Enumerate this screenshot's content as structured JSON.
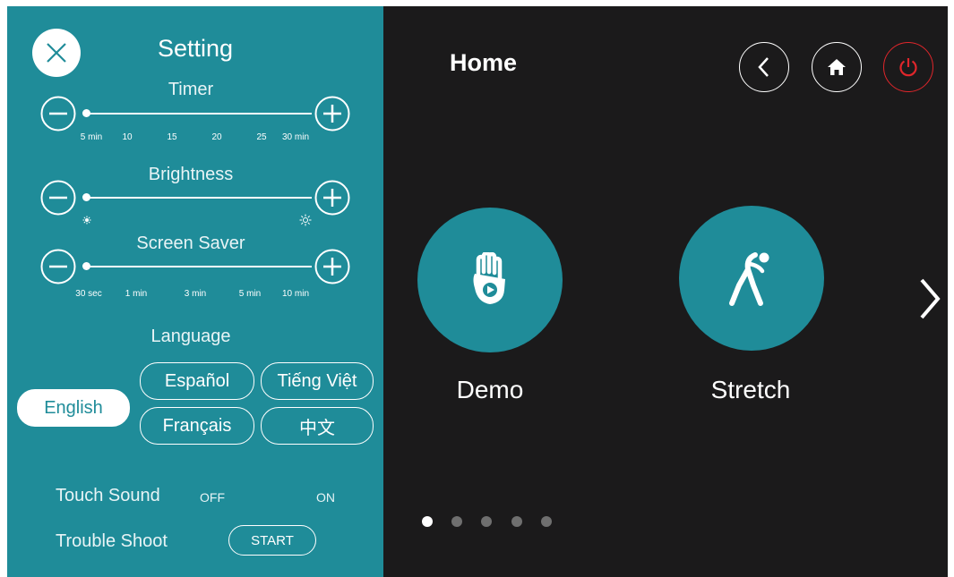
{
  "settings": {
    "title": "Setting",
    "timer": {
      "label": "Timer",
      "ticks": [
        "5 min",
        "10",
        "15",
        "20",
        "25",
        "30 min"
      ],
      "value": 0
    },
    "brightness": {
      "label": "Brightness",
      "value": 0
    },
    "screen_saver": {
      "label": "Screen Saver",
      "ticks": [
        "30 sec",
        "1 min",
        "3 min",
        "5 min",
        "10 min"
      ],
      "value": 0
    },
    "language": {
      "label": "Language",
      "options": [
        "English",
        "Español",
        "Tiếng Việt",
        "Français",
        "中文"
      ],
      "selected": "English"
    },
    "touch_sound": {
      "label": "Touch Sound",
      "off": "OFF",
      "on": "ON"
    },
    "trouble_shoot": {
      "label": "Trouble Shoot",
      "button": "START"
    }
  },
  "home": {
    "title": "Home",
    "apps": [
      {
        "label": "Demo",
        "icon": "hand-play-icon"
      },
      {
        "label": "Stretch",
        "icon": "stretch-figure-icon"
      }
    ],
    "page_indicator": {
      "total": 5,
      "current": 1
    },
    "colors": {
      "accent": "#1f8c99",
      "power": "#e0262b",
      "background": "#1b1a1b"
    }
  }
}
